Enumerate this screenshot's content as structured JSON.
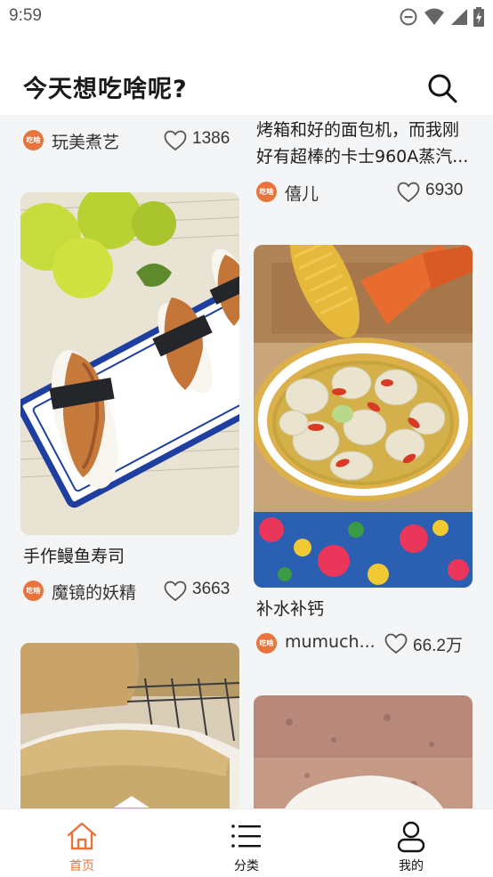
{
  "status_bar": {
    "time": "9:59"
  },
  "header": {
    "title": "今天想吃啥呢?"
  },
  "feed": {
    "left": [
      {
        "author": "玩美煮艺",
        "likes": "1386"
      },
      {
        "title": "手作鳗鱼寿司",
        "author": "魔镜的妖精",
        "likes": "3663"
      }
    ],
    "right": [
      {
        "title_line1": "烤箱和好的面包机，而我刚",
        "title_line2": "好有超棒的卡士960A蒸汽...",
        "author": "僖儿",
        "likes": "6930"
      },
      {
        "title": "补水补钙",
        "author": "mumuch...",
        "likes": "66.2万"
      }
    ]
  },
  "badge_text": "吃啥",
  "tabbar": {
    "tabs": [
      {
        "label": "首页",
        "icon": "home-icon"
      },
      {
        "label": "分类",
        "icon": "list-icon"
      },
      {
        "label": "我的",
        "icon": "user-icon"
      }
    ]
  },
  "colors": {
    "accent": "#e8743b",
    "background": "#f4f5f7"
  }
}
